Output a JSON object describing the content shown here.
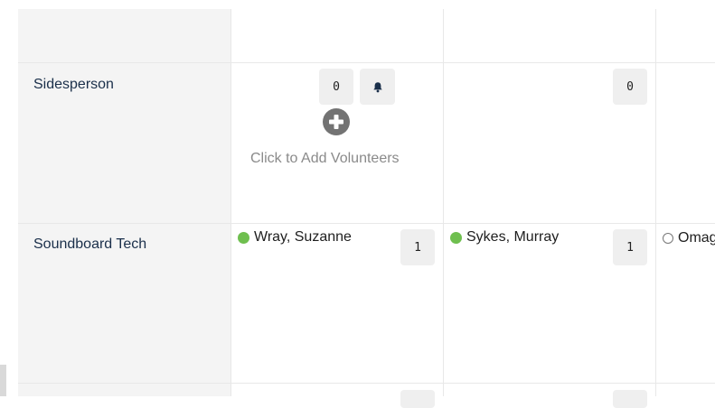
{
  "roles": [
    {
      "label": "Sidesperson"
    },
    {
      "label": "Soundboard Tech"
    }
  ],
  "sidesperson": {
    "col1_count": "0",
    "col2_count": "0",
    "add_volunteers_text": "Click to Add Volunteers"
  },
  "soundboard": {
    "col1_volunteer": "Wray, Suzanne",
    "col1_count": "1",
    "col2_volunteer": "Sykes, Murray",
    "col2_count": "1",
    "col3_volunteer": "Omag"
  },
  "colors": {
    "status_confirmed": "#6fbf4f",
    "role_label": "#1a2f4a",
    "role_column_bg": "#f4f4f4"
  }
}
